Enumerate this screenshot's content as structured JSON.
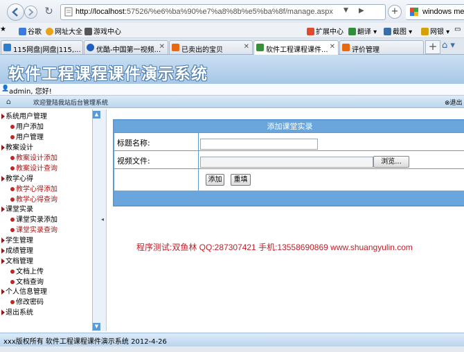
{
  "browser": {
    "url_host": "http://localhost",
    "url_rest": ":57526/%e6%ba%90%e7%a8%8b%e5%ba%8f/manage.aspx",
    "search_text": "windows med"
  },
  "favorites": [
    {
      "label": "谷歌",
      "color": "#3b7be0"
    },
    {
      "label": "网址大全",
      "color": "#e8a317"
    },
    {
      "label": "游戏中心",
      "color": "#555555"
    },
    {
      "label": "扩展中心",
      "color": "#e04a2f"
    },
    {
      "label": "翻译",
      "color": "#2f8f3a"
    },
    {
      "label": "截图",
      "color": "#3a6ea5"
    },
    {
      "label": "网银",
      "color": "#d4a10a"
    }
  ],
  "tabs": [
    {
      "label": "115网盘|网盘|115,...",
      "active": false,
      "color": "#2a7fd0"
    },
    {
      "label": "优酷-中国第一视频...",
      "active": false,
      "color": "#1f5fbf"
    },
    {
      "label": "已卖出的宝贝",
      "active": false,
      "color": "#e86a10"
    },
    {
      "label": "软件工程课程课件...",
      "active": true,
      "color": "#3a8f3a"
    },
    {
      "label": "评价管理",
      "active": false,
      "color": "#e86a10"
    }
  ],
  "page": {
    "title": "软件工程课程课件演示系统",
    "user_greeting": "admin, 您好!",
    "welcome": "欢迎登陆我站后台管理系统",
    "logout": "退出"
  },
  "sidebar": [
    {
      "label": "系统用户管理",
      "items": [
        {
          "label": "用户添加",
          "red": false
        },
        {
          "label": "用户管理",
          "red": false
        }
      ]
    },
    {
      "label": "教案设计",
      "items": [
        {
          "label": "教案设计添加",
          "red": true
        },
        {
          "label": "教案设计查询",
          "red": true
        }
      ]
    },
    {
      "label": "教学心得",
      "items": [
        {
          "label": "教学心得添加",
          "red": true
        },
        {
          "label": "教学心得查询",
          "red": true
        }
      ]
    },
    {
      "label": "课堂实录",
      "items": [
        {
          "label": "课堂实录添加",
          "red": false
        },
        {
          "label": "课堂实录查询",
          "red": true
        }
      ]
    },
    {
      "label": "学生管理",
      "items": []
    },
    {
      "label": "成绩管理",
      "items": []
    },
    {
      "label": "文档管理",
      "items": [
        {
          "label": "文档上传",
          "red": false
        },
        {
          "label": "文档查询",
          "red": false
        }
      ]
    },
    {
      "label": "个人信息管理",
      "items": [
        {
          "label": "修改密码",
          "red": false
        }
      ]
    },
    {
      "label": "退出系统",
      "items": []
    }
  ],
  "form": {
    "header": "添加课堂实录",
    "title_label": "标题名称:",
    "title_value": "",
    "file_label": "视频文件:",
    "browse_label": "浏览...",
    "submit_label": "添加",
    "reset_label": "重填"
  },
  "credit": "程序测试:双鱼林 QQ:287307421 手机:13558690869 www.shuangyulin.com",
  "footer": "xxx版权所有 软件工程课程课件演示系统 2012-4-26"
}
